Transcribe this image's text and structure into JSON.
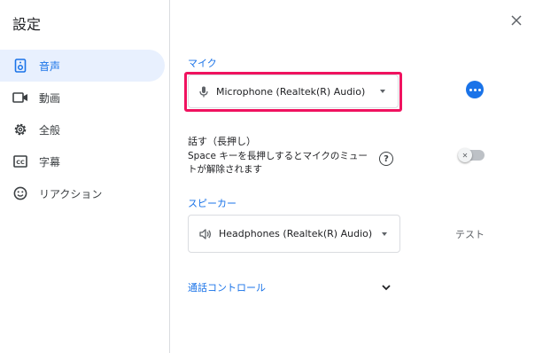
{
  "dialog": {
    "title": "設定"
  },
  "sidebar": {
    "items": [
      {
        "label": "音声",
        "icon": "speaker-icon",
        "active": true
      },
      {
        "label": "動画",
        "icon": "videocam-icon",
        "active": false
      },
      {
        "label": "全般",
        "icon": "gear-icon",
        "active": false
      },
      {
        "label": "字幕",
        "icon": "captions-icon",
        "active": false
      },
      {
        "label": "リアクション",
        "icon": "smiley-icon",
        "active": false
      }
    ]
  },
  "microphone": {
    "section_label": "マイク",
    "selected": "Microphone (Realtek(R) Audio)",
    "icon": "mic-icon"
  },
  "push_to_talk": {
    "title": "話す（長押し）",
    "description": "Space キーを長押しするとマイクのミュートが解除されます",
    "enabled": false
  },
  "speaker": {
    "section_label": "スピーカー",
    "selected": "Headphones (Realtek(R) Audio)",
    "icon": "volume-icon",
    "test_label": "テスト"
  },
  "call_control": {
    "label": "通話コントロール"
  },
  "colors": {
    "accent": "#1a73e8",
    "highlight": "#f0125f",
    "active_bg": "#e8f0fe"
  }
}
